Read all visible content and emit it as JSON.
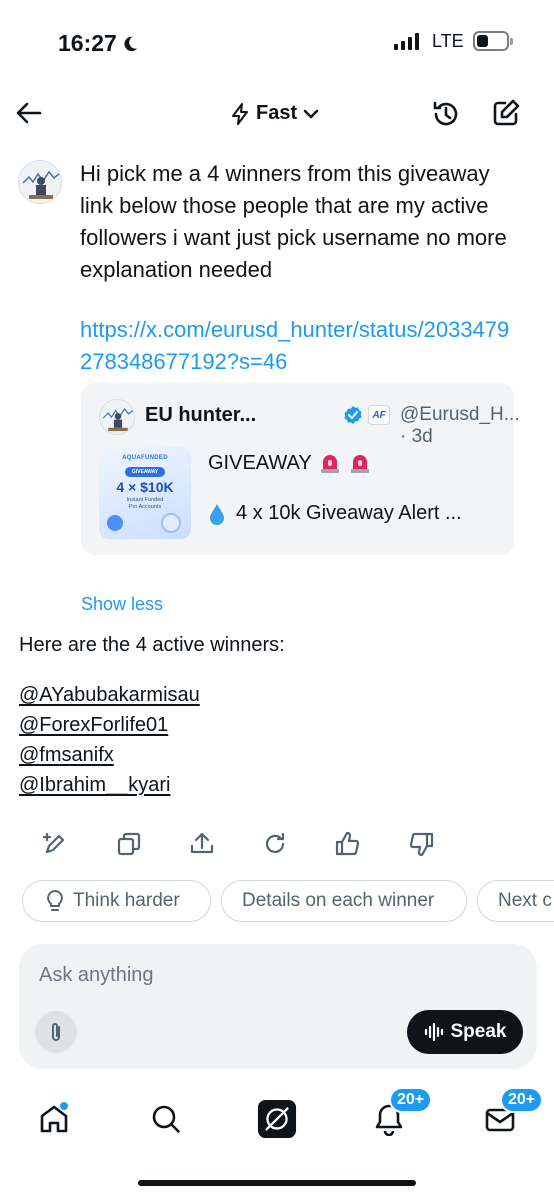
{
  "status_bar": {
    "time": "16:27",
    "network": "LTE",
    "battery_level": 0.4
  },
  "header": {
    "mode_label": "Fast"
  },
  "user_message": {
    "text": "Hi pick me a 4 winners from this giveaway link below those people that are my active followers i want just pick username no more explanation needed",
    "link": "https://x.com/eurusd_hunter/status/2033479278348677192?s=46"
  },
  "quoted_post": {
    "author_name": "EU hunter...",
    "affiliate_badge": "AF",
    "handle_time": "@Eurusd_H... · 3d",
    "title": "GIVEAWAY",
    "preview": "4 x 10k Giveaway Alert ...",
    "thumbnail": {
      "brand": "AQUAFUNDED",
      "pill": "GIVEAWAY",
      "amount": "4 × $10K",
      "sub1": "Instant Funded",
      "sub2": "Pro Accounts"
    }
  },
  "show_less_label": "Show less",
  "response": {
    "intro": "Here are the 4 active winners:",
    "winners": [
      "@AYabubakarmisau",
      "@ForexForlife01",
      "@fmsanifx",
      "@Ibrahim__kyari"
    ]
  },
  "suggestions": [
    "Think harder",
    "Details on each winner",
    "Next c"
  ],
  "composer": {
    "placeholder": "Ask anything",
    "speak_label": "Speak"
  },
  "bottom_nav": {
    "notifications_badge": "20+",
    "messages_badge": "20+"
  },
  "colors": {
    "accent": "#1d9bf0",
    "text": "#0f1419",
    "muted": "#536471",
    "composer_bg": "#eff3f4",
    "card_bg": "#f2f4f5"
  }
}
